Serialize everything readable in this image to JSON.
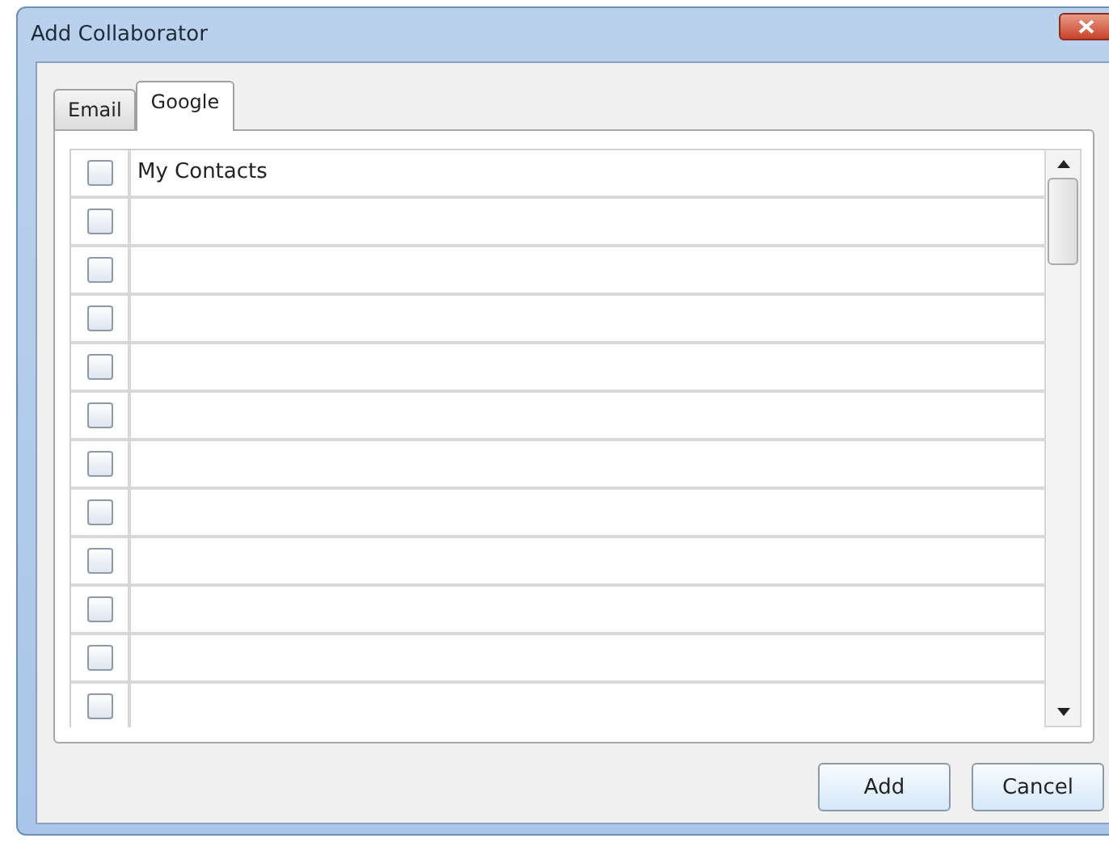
{
  "window": {
    "title": "Add Collaborator"
  },
  "tabs": [
    {
      "label": "Email",
      "selected": false
    },
    {
      "label": "Google",
      "selected": true
    }
  ],
  "rows": [
    {
      "label": "My Contacts",
      "checked": false
    },
    {
      "checked": false
    },
    {
      "checked": false
    },
    {
      "checked": false
    },
    {
      "checked": false
    },
    {
      "checked": false
    },
    {
      "checked": false
    },
    {
      "checked": false
    },
    {
      "checked": false
    },
    {
      "checked": false
    },
    {
      "checked": false
    },
    {
      "checked": false
    }
  ],
  "buttons": [
    {
      "label": "Add"
    },
    {
      "label": "Cancel"
    }
  ]
}
